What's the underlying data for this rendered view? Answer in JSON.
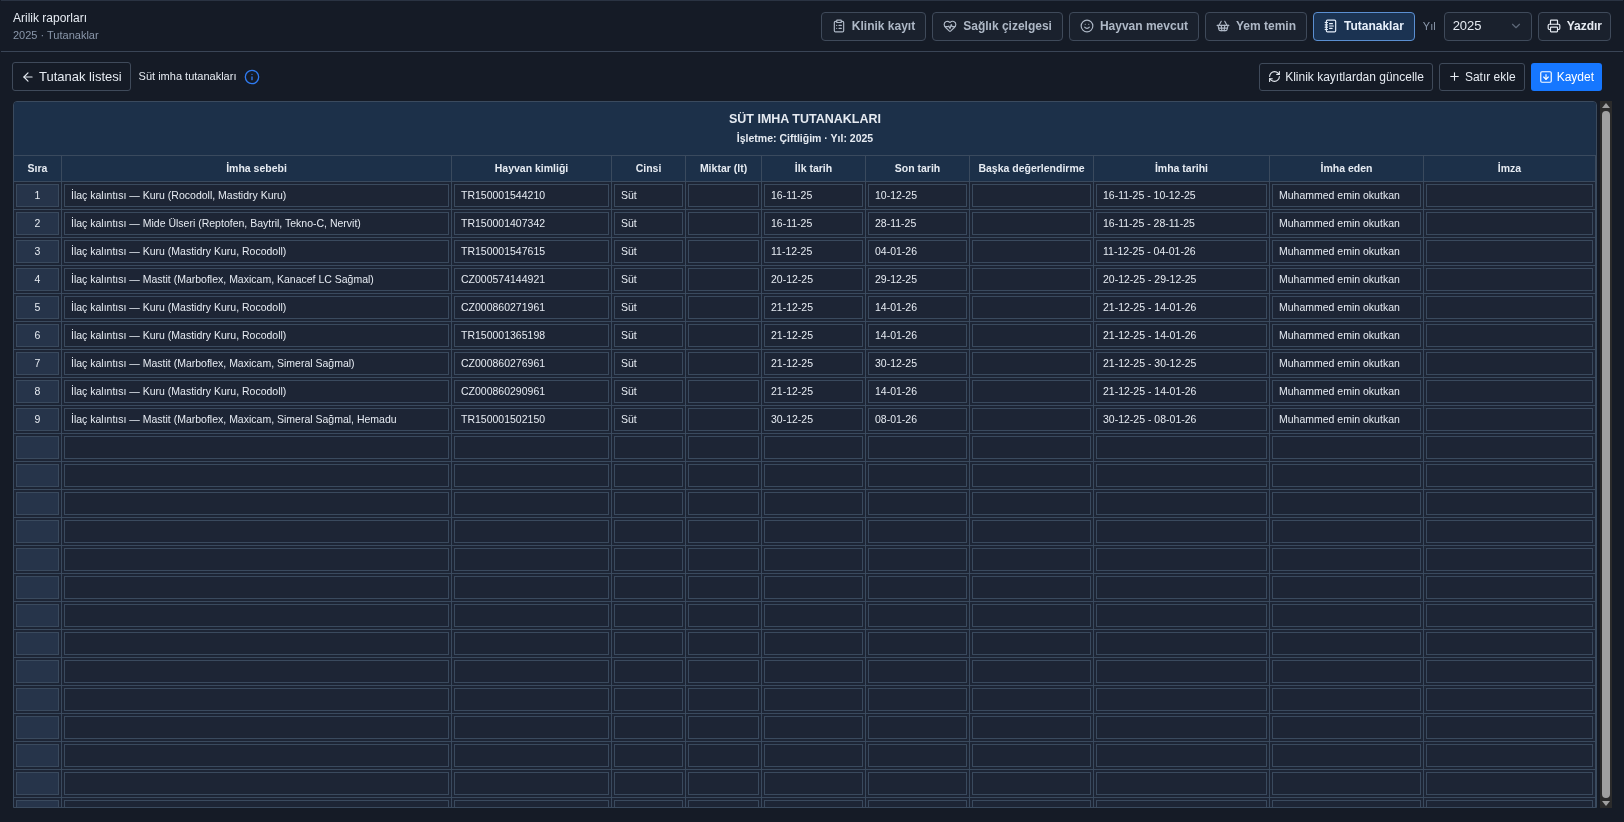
{
  "header": {
    "title": "Arilik raporları",
    "subtitle": "2025 · Tutanaklar"
  },
  "tabs": [
    {
      "label": "Klinik kayıt",
      "selected": false
    },
    {
      "label": "Sağlık çizelgesi",
      "selected": false
    },
    {
      "label": "Hayvan mevcut",
      "selected": false
    },
    {
      "label": "Yem temin",
      "selected": false
    },
    {
      "label": "Tutanaklar",
      "selected": true
    }
  ],
  "year": {
    "label": "Yıl",
    "value": "2025"
  },
  "print_button": "Yazdır",
  "toolbar": {
    "back_button": "Tutanak listesi",
    "section_label": "Süt imha tutanakları",
    "actions": [
      "Klinik kayıtlardan güncelle",
      "Satır ekle"
    ],
    "save_button": "Kaydet"
  },
  "table": {
    "title": "SÜT IMHA TUTANAKLARI",
    "subtitle": "İşletme: Çiftliğim · Yıl: 2025",
    "columns": [
      "Sıra",
      "İmha sebebi",
      "Hayvan kimliği",
      "Cinsi",
      "Miktar (lt)",
      "İlk tarih",
      "Son tarih",
      "Başka değerlendirme",
      "İmha tarihi",
      "İmha eden",
      "İmza"
    ],
    "rows": [
      {
        "kind": "filled",
        "sira": "1",
        "sebep": "İlaç kalıntısı — Kuru (Rocodoll, Mastidry Kuru)",
        "hayvan": "TR150001544210",
        "cins": "Süt",
        "ilk": "16-11-25",
        "son": "10-12-25",
        "imha_tarihi": "16-11-25 - 10-12-25",
        "imha_eden": "Muhammed emin okutkan"
      },
      {
        "kind": "filled",
        "sira": "2",
        "sebep": "İlaç kalıntısı — Mide Ülseri (Reptofen, Baytril, Tekno-C, Nervit)",
        "hayvan": "TR150001407342",
        "cins": "Süt",
        "ilk": "16-11-25",
        "son": "28-11-25",
        "imha_tarihi": "16-11-25 - 28-11-25",
        "imha_eden": "Muhammed emin okutkan"
      },
      {
        "kind": "filled",
        "sira": "3",
        "sebep": "İlaç kalıntısı — Kuru (Mastidry Kuru, Rocodoll)",
        "hayvan": "TR150001547615",
        "cins": "Süt",
        "ilk": "11-12-25",
        "son": "04-01-26",
        "imha_tarihi": "11-12-25 - 04-01-26",
        "imha_eden": "Muhammed emin okutkan"
      },
      {
        "kind": "filled",
        "sira": "4",
        "sebep": "İlaç kalıntısı — Mastit (Marboflex, Maxicam, Kanacef LC Sağmal)",
        "hayvan": "CZ000574144921",
        "cins": "Süt",
        "ilk": "20-12-25",
        "son": "29-12-25",
        "imha_tarihi": "20-12-25 - 29-12-25",
        "imha_eden": "Muhammed emin okutkan"
      },
      {
        "kind": "filled",
        "sira": "5",
        "sebep": "İlaç kalıntısı — Kuru (Mastidry Kuru, Rocodoll)",
        "hayvan": "CZ000860271961",
        "cins": "Süt",
        "ilk": "21-12-25",
        "son": "14-01-26",
        "imha_tarihi": "21-12-25 - 14-01-26",
        "imha_eden": "Muhammed emin okutkan"
      },
      {
        "kind": "filled",
        "sira": "6",
        "sebep": "İlaç kalıntısı — Kuru (Mastidry Kuru, Rocodoll)",
        "hayvan": "TR150001365198",
        "cins": "Süt",
        "ilk": "21-12-25",
        "son": "14-01-26",
        "imha_tarihi": "21-12-25 - 14-01-26",
        "imha_eden": "Muhammed emin okutkan"
      },
      {
        "kind": "filled",
        "sira": "7",
        "sebep": "İlaç kalıntısı — Mastit (Marboflex, Maxicam, Simeral Sağmal)",
        "hayvan": "CZ000860276961",
        "cins": "Süt",
        "ilk": "21-12-25",
        "son": "30-12-25",
        "imha_tarihi": "21-12-25 - 30-12-25",
        "imha_eden": "Muhammed emin okutkan"
      },
      {
        "kind": "filled",
        "sira": "8",
        "sebep": "İlaç kalıntısı — Kuru (Mastidry Kuru, Rocodoll)",
        "hayvan": "CZ000860290961",
        "cins": "Süt",
        "ilk": "21-12-25",
        "son": "14-01-26",
        "imha_tarihi": "21-12-25 - 14-01-26",
        "imha_eden": "Muhammed emin okutkan"
      },
      {
        "kind": "filled",
        "sira": "9",
        "sebep": "İlaç kalıntısı — Mastit (Marboflex, Maxicam, Simeral Sağmal, Hemadu",
        "hayvan": "TR150001502150",
        "cins": "Süt",
        "ilk": "30-12-25",
        "son": "08-01-26",
        "imha_tarihi": "30-12-25 - 08-01-26",
        "imha_eden": "Muhammed emin okutkan"
      },
      {
        "kind": "blank"
      },
      {
        "kind": "blank"
      },
      {
        "kind": "blank"
      },
      {
        "kind": "blank"
      },
      {
        "kind": "blank"
      },
      {
        "kind": "blank"
      },
      {
        "kind": "blank"
      },
      {
        "kind": "blank"
      },
      {
        "kind": "blank"
      },
      {
        "kind": "blank"
      },
      {
        "kind": "blank"
      },
      {
        "kind": "blank"
      },
      {
        "kind": "blank"
      },
      {
        "kind": "blank"
      }
    ]
  }
}
